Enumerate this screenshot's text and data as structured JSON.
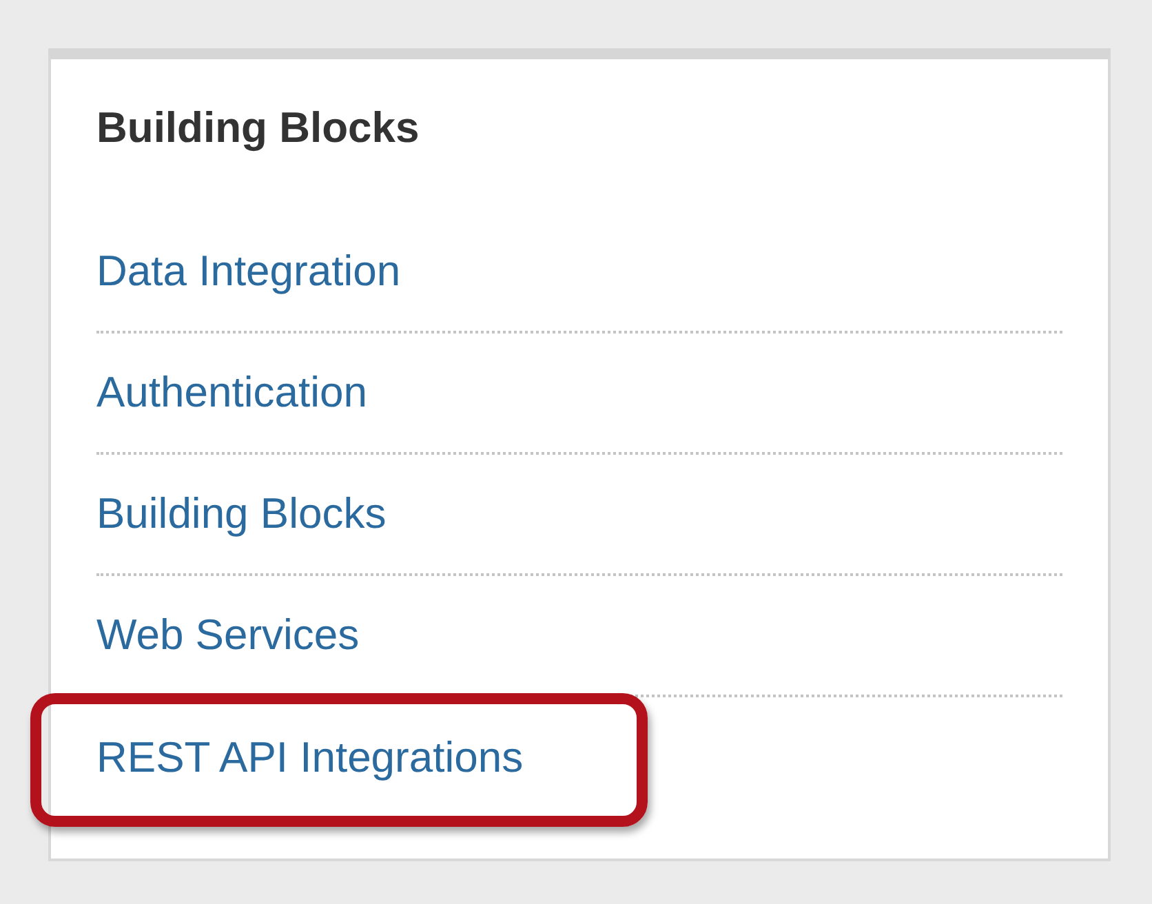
{
  "panel": {
    "title": "Building Blocks",
    "links": [
      {
        "label": "Data Integration",
        "highlighted": false
      },
      {
        "label": "Authentication",
        "highlighted": false
      },
      {
        "label": "Building Blocks",
        "highlighted": false
      },
      {
        "label": "Web Services",
        "highlighted": false
      },
      {
        "label": "REST API Integrations",
        "highlighted": true
      }
    ]
  }
}
